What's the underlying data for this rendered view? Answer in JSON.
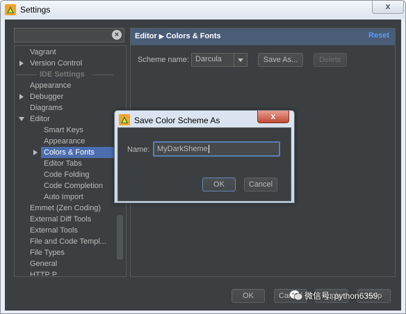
{
  "window": {
    "title": "Settings",
    "close_label": "x"
  },
  "search": {
    "placeholder": "",
    "clear_icon": "clear-icon"
  },
  "tree": {
    "items": [
      {
        "label": "Vagrant"
      },
      {
        "label": "Version Control"
      },
      {
        "label": "IDE Settings"
      },
      {
        "label": "Appearance"
      },
      {
        "label": "Debugger"
      },
      {
        "label": "Diagrams"
      },
      {
        "label": "Editor"
      },
      {
        "label": "Smart Keys"
      },
      {
        "label": "Appearance"
      },
      {
        "label": "Colors & Fonts"
      },
      {
        "label": "Editor Tabs"
      },
      {
        "label": "Code Folding"
      },
      {
        "label": "Code Completion"
      },
      {
        "label": "Auto Import"
      },
      {
        "label": "Emmet (Zen Coding)"
      },
      {
        "label": "External Diff Tools"
      },
      {
        "label": "External Tools"
      },
      {
        "label": "File and Code Templ..."
      },
      {
        "label": "File Types"
      },
      {
        "label": "General"
      },
      {
        "label": "HTTP P..."
      }
    ]
  },
  "panel": {
    "breadcrumb_parent": "Editor",
    "breadcrumb_child": "Colors & Fonts",
    "reset_label": "Reset",
    "scheme_label": "Scheme name:",
    "scheme_value": "Darcula",
    "save_as_label": "Save As...",
    "delete_label": "Delete"
  },
  "footer": {
    "ok_label": "OK",
    "cancel_label": "Cancel",
    "apply_label": "Apply",
    "help_label": "Help"
  },
  "watermark": {
    "text": "微信号: python6359"
  },
  "dialog": {
    "title": "Save Color Scheme As",
    "close_label": "x",
    "name_label": "Name:",
    "name_value": "MyDarkSheme",
    "ok_label": "OK",
    "cancel_label": "Cancel"
  },
  "colors": {
    "bg_dark": "#3c3f41",
    "selection": "#4b6eaf",
    "header": "#4a5c76",
    "link": "#589df6"
  }
}
